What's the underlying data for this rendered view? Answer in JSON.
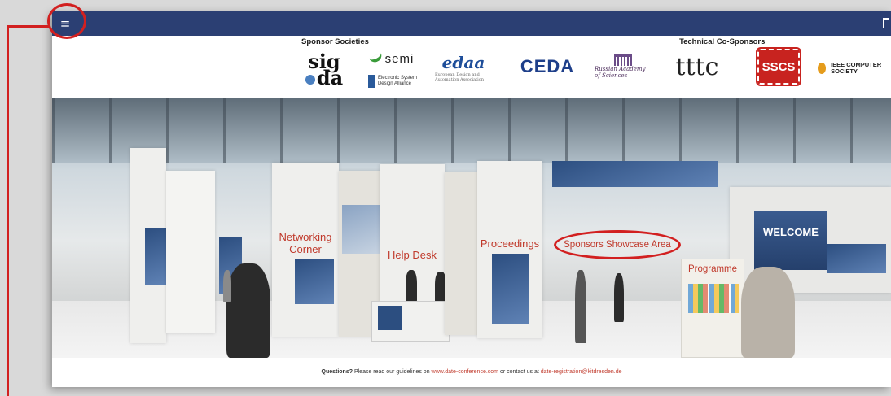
{
  "topbar": {
    "menu_icon": "hamburger-menu-icon",
    "menu_glyph": "≡",
    "color": "#2b3f73"
  },
  "sponsors": {
    "left_heading": "Sponsor Societies",
    "right_heading": "Technical Co-Sponsors",
    "logos": {
      "sigda_top": "sig",
      "sigda_bottom": "da",
      "semi": "semi",
      "esd": "Electronic System Design Alliance",
      "edaa": "edaa",
      "edaa_sub": "European Design and Automation Association",
      "ceda": "CEDA",
      "russian": "Russian Academy of Sciences",
      "tttc": "tttc",
      "sscs": "SSCS",
      "ieee": "IEEE COMPUTER SOCIETY"
    }
  },
  "hall": {
    "networking": "Networking Corner",
    "help_desk": "Help Desk",
    "proceedings": "Proceedings",
    "sponsors_showcase": "Sponsors Showcase Area",
    "welcome": "WELCOME",
    "programme": "Programme"
  },
  "footer": {
    "questions_label": "Questions?",
    "text1": " Please read our guidelines on ",
    "link1": "www.date-conference.com",
    "text2": " or contact us at ",
    "link2": "date-registration@kitdresden.de"
  },
  "annotation": {
    "color": "#d22020"
  }
}
